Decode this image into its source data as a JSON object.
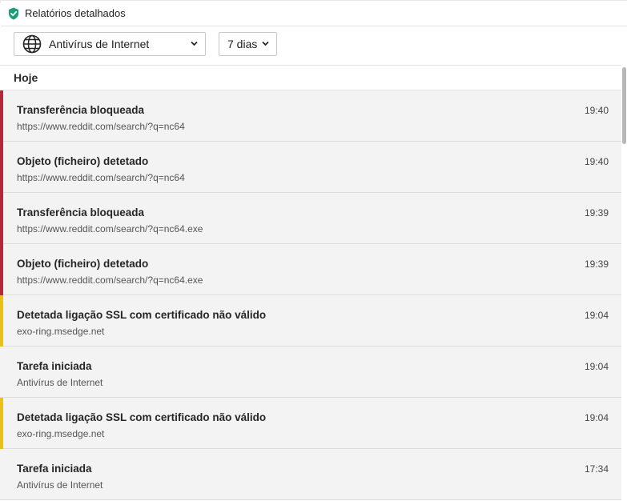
{
  "window": {
    "title": "Relatórios detalhados",
    "icon": "shield-check-icon"
  },
  "filters": {
    "component": {
      "label": "Antivírus de Internet",
      "icon": "globe-icon"
    },
    "period": {
      "label": "7 dias"
    }
  },
  "section": {
    "label": "Hoje"
  },
  "colors": {
    "danger": "#b02a3a",
    "warning": "#e8c21a",
    "neutral": "#f3f3f3"
  },
  "events": [
    {
      "title": "Transferência bloqueada",
      "detail": "https://www.reddit.com/search/?q=nc64",
      "time": "19:40",
      "severity": "danger"
    },
    {
      "title": "Objeto (ficheiro) detetado",
      "detail": "https://www.reddit.com/search/?q=nc64",
      "time": "19:40",
      "severity": "danger"
    },
    {
      "title": "Transferência bloqueada",
      "detail": "https://www.reddit.com/search/?q=nc64.exe",
      "time": "19:39",
      "severity": "danger"
    },
    {
      "title": "Objeto (ficheiro) detetado",
      "detail": "https://www.reddit.com/search/?q=nc64.exe",
      "time": "19:39",
      "severity": "danger"
    },
    {
      "title": "Detetada ligação SSL com certificado não válido",
      "detail": "exo-ring.msedge.net",
      "time": "19:04",
      "severity": "warning"
    },
    {
      "title": "Tarefa iniciada",
      "detail": "Antivírus de Internet",
      "time": "19:04",
      "severity": "info"
    },
    {
      "title": "Detetada ligação SSL com certificado não válido",
      "detail": "exo-ring.msedge.net",
      "time": "19:04",
      "severity": "warning"
    },
    {
      "title": "Tarefa iniciada",
      "detail": "Antivírus de Internet",
      "time": "17:34",
      "severity": "info"
    }
  ]
}
